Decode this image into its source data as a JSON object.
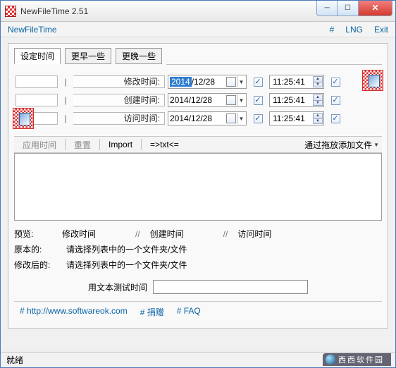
{
  "window": {
    "title": "NewFileTime 2.51"
  },
  "menubar": {
    "left_item": "NewFileTime",
    "hash": "#",
    "lng": "LNG",
    "exit": "Exit"
  },
  "tabs": {
    "set_time": "设定时间",
    "earlier": "更早一些",
    "later": "更晚一些"
  },
  "rows": {
    "modify": {
      "label": "修改时间:",
      "date_year": "2014",
      "date_rest": "/12/28",
      "time": "11:25:41"
    },
    "create": {
      "label": "创建时间:",
      "date": "2014/12/28",
      "time": "11:25:41"
    },
    "access": {
      "label": "访问时间:",
      "date": "2014/12/28",
      "time": "11:25:41"
    }
  },
  "toolbar": {
    "apply": "应用时间",
    "reset": "重置",
    "import": "Import",
    "txt": "=>txt<=",
    "add_files": "通过拖放添加文件"
  },
  "info": {
    "preview": "预览:",
    "col_modify": "修改时间",
    "col_create": "创建时间",
    "col_access": "访问时间",
    "slash": "//",
    "original": "原本的:",
    "after": "修改后的:",
    "placeholder": "请选择列表中的一个文件夹/文件"
  },
  "test": {
    "label": "用文本测试时间"
  },
  "footer": {
    "url": "# http://www.softwareok.com",
    "donate": "# 捐赠",
    "faq": "# FAQ"
  },
  "status": {
    "ready": "就绪"
  },
  "watermark": "西西软件园"
}
